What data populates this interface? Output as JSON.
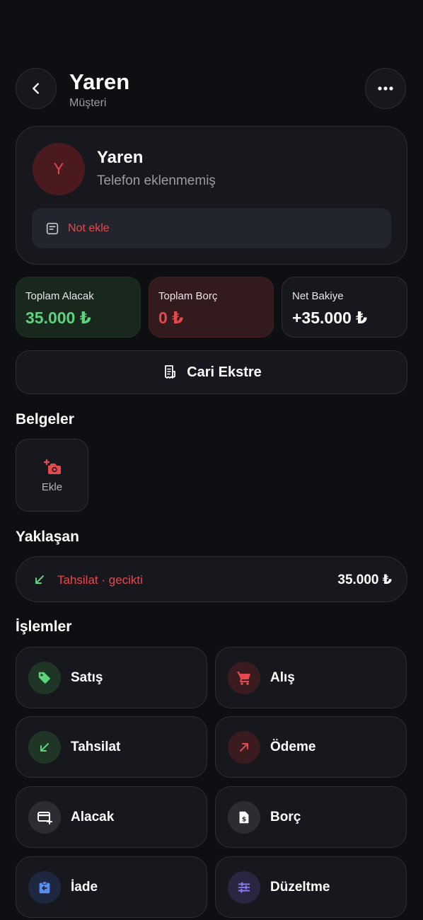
{
  "header": {
    "title": "Yaren",
    "subtitle": "Müşteri"
  },
  "profile": {
    "avatar_letter": "Y",
    "name": "Yaren",
    "phone_text": "Telefon eklenmemiş",
    "note_label": "Not ekle"
  },
  "stats": {
    "receivable": {
      "label": "Toplam Alacak",
      "value": "35.000 ₺"
    },
    "debt": {
      "label": "Toplam Borç",
      "value": "0 ₺"
    },
    "net": {
      "label": "Net Bakiye",
      "value": "+35.000 ₺"
    }
  },
  "statement_button": "Cari Ekstre",
  "documents": {
    "title": "Belgeler",
    "add_label": "Ekle"
  },
  "upcoming": {
    "title": "Yaklaşan",
    "item": {
      "label": "Tahsilat · gecikti",
      "amount": "35.000 ₺"
    }
  },
  "operations": {
    "title": "İşlemler",
    "items": [
      {
        "label": "Satış",
        "icon": "tag-icon"
      },
      {
        "label": "Alış",
        "icon": "cart-icon"
      },
      {
        "label": "Tahsilat",
        "icon": "arrow-down-left-icon"
      },
      {
        "label": "Ödeme",
        "icon": "arrow-up-right-icon"
      },
      {
        "label": "Alacak",
        "icon": "card-plus-icon"
      },
      {
        "label": "Borç",
        "icon": "document-dollar-icon"
      },
      {
        "label": "İade",
        "icon": "return-icon"
      },
      {
        "label": "Düzeltme",
        "icon": "sliders-icon"
      }
    ]
  },
  "colors": {
    "background": "#0e0f13",
    "card": "#17181d",
    "green": "#5dd37c",
    "red": "#e5484d",
    "purple": "#8b7cf6",
    "blue": "#5b8def"
  }
}
